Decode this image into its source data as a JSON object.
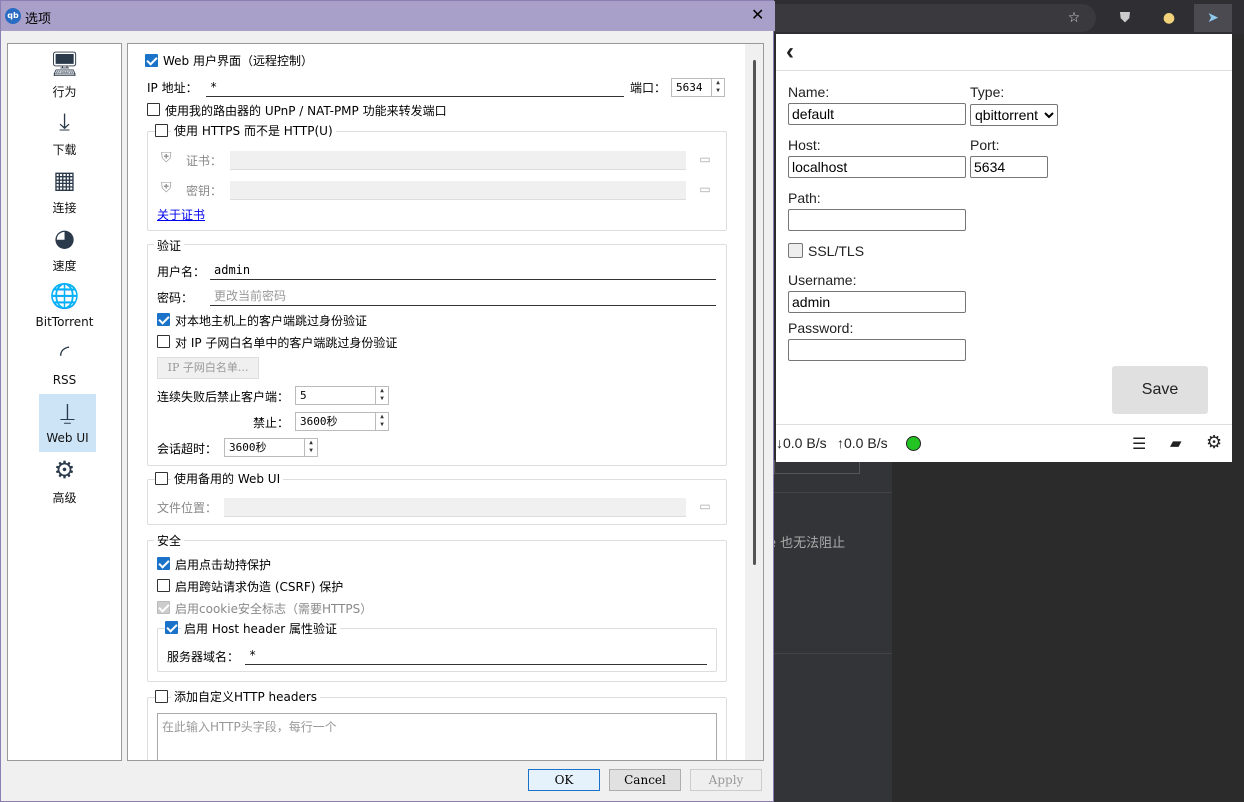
{
  "browser": {
    "icons": [
      "star-add-icon",
      "shield-icon",
      "circle-icon",
      "send-icon"
    ],
    "bg_text": "e 也无法阻止"
  },
  "popup": {
    "back": "‹",
    "name_label": "Name:",
    "name_value": "default",
    "type_label": "Type:",
    "type_value": "qbittorrent",
    "host_label": "Host:",
    "host_value": "localhost",
    "port_label": "Port:",
    "port_value": "5634",
    "path_label": "Path:",
    "path_value": "",
    "ssl_label": "SSL/TLS",
    "username_label": "Username:",
    "username_value": "admin",
    "password_label": "Password:",
    "password_value": "",
    "save_label": "Save",
    "down_speed": "↓0.0 B/s",
    "up_speed": "↑0.0 B/s",
    "status_color": "#22c322"
  },
  "dialog": {
    "title": "选项",
    "close": "✕",
    "nav": [
      {
        "label": "行为",
        "icon": "monitor-gear-icon"
      },
      {
        "label": "下载",
        "icon": "download-icon"
      },
      {
        "label": "连接",
        "icon": "network-icon"
      },
      {
        "label": "速度",
        "icon": "speedometer-icon"
      },
      {
        "label": "BitTorrent",
        "icon": "globe-gear-icon"
      },
      {
        "label": "RSS",
        "icon": "rss-icon"
      },
      {
        "label": "Web UI",
        "icon": "webui-icon"
      },
      {
        "label": "高级",
        "icon": "gears-icon"
      }
    ],
    "webui_enable": "Web 用户界面（远程控制）",
    "ip_label": "IP 地址：",
    "ip_value": "*",
    "port_label": "端口：",
    "port_value": "5634",
    "upnp_label": "使用我的路由器的 UPnP / NAT-PMP 功能来转发端口",
    "https_label": "使用 HTTPS 而不是 HTTP(U)",
    "cert_label": "证书：",
    "key_label": "密钥：",
    "cert_link": "关于证书",
    "auth_title": "验证",
    "username_label": "用户名：",
    "username_value": "admin",
    "password_label": "密码：",
    "password_placeholder": "更改当前密码",
    "bypass_local": "对本地主机上的客户端跳过身份验证",
    "bypass_subnet": "对 IP 子网白名单中的客户端跳过身份验证",
    "subnet_button": "IP 子网白名单...",
    "ban_after_label": "连续失败后禁止客户端：",
    "ban_after_value": "5",
    "ban_label": "禁止：",
    "ban_value": "3600秒",
    "session_label": "会话超时：",
    "session_value": "3600秒",
    "alt_webui": "使用备用的 Web UI",
    "file_loc_label": "文件位置：",
    "security_title": "安全",
    "clickjack": "启用点击劫持保护",
    "csrf": "启用跨站请求伪造 (CSRF) 保护",
    "cookie": "启用cookie安全标志（需要HTTPS）",
    "host_header": "启用 Host header 属性验证",
    "server_domain_label": "服务器域名：",
    "server_domain_value": "*",
    "custom_headers": "添加自定义HTTP headers",
    "headers_placeholder": "在此输入HTTP头字段，每行一个",
    "ok": "OK",
    "cancel": "Cancel",
    "apply": "Apply"
  }
}
